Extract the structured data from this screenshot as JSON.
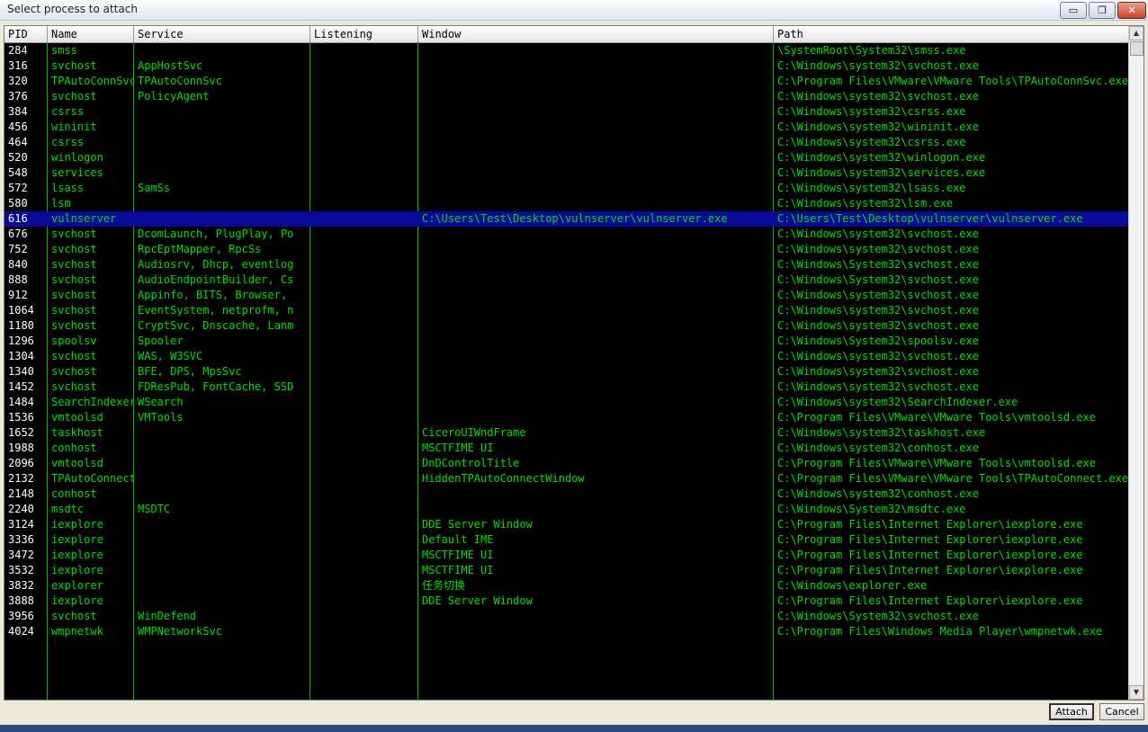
{
  "window": {
    "title": "Select process to attach"
  },
  "columns": [
    {
      "key": "pid",
      "label": "PID"
    },
    {
      "key": "name",
      "label": "Name"
    },
    {
      "key": "service",
      "label": "Service"
    },
    {
      "key": "listening",
      "label": "Listening"
    },
    {
      "key": "window",
      "label": "Window"
    },
    {
      "key": "path",
      "label": "Path"
    }
  ],
  "rows": [
    {
      "pid": "284",
      "name": "smss",
      "service": "",
      "listening": "",
      "window": "",
      "path": "\\SystemRoot\\System32\\smss.exe"
    },
    {
      "pid": "316",
      "name": "svchost",
      "service": "AppHostSvc",
      "listening": "",
      "window": "",
      "path": "C:\\Windows\\system32\\svchost.exe"
    },
    {
      "pid": "320",
      "name": "TPAutoConnSvc",
      "service": "TPAutoConnSvc",
      "listening": "",
      "window": "",
      "path": "C:\\Program Files\\VMware\\VMware Tools\\TPAutoConnSvc.exe"
    },
    {
      "pid": "376",
      "name": "svchost",
      "service": "PolicyAgent",
      "listening": "",
      "window": "",
      "path": "C:\\Windows\\system32\\svchost.exe"
    },
    {
      "pid": "384",
      "name": "csrss",
      "service": "",
      "listening": "",
      "window": "",
      "path": "C:\\Windows\\system32\\csrss.exe"
    },
    {
      "pid": "456",
      "name": "wininit",
      "service": "",
      "listening": "",
      "window": "",
      "path": "C:\\Windows\\system32\\wininit.exe"
    },
    {
      "pid": "464",
      "name": "csrss",
      "service": "",
      "listening": "",
      "window": "",
      "path": "C:\\Windows\\system32\\csrss.exe"
    },
    {
      "pid": "520",
      "name": "winlogon",
      "service": "",
      "listening": "",
      "window": "",
      "path": "C:\\Windows\\system32\\winlogon.exe"
    },
    {
      "pid": "548",
      "name": "services",
      "service": "",
      "listening": "",
      "window": "",
      "path": "C:\\Windows\\system32\\services.exe"
    },
    {
      "pid": "572",
      "name": "lsass",
      "service": "SamSs",
      "listening": "",
      "window": "",
      "path": "C:\\Windows\\system32\\lsass.exe"
    },
    {
      "pid": "580",
      "name": "lsm",
      "service": "",
      "listening": "",
      "window": "",
      "path": "C:\\Windows\\system32\\lsm.exe"
    },
    {
      "pid": "616",
      "name": "vulnserver",
      "service": "",
      "listening": "",
      "window": "C:\\Users\\Test\\Desktop\\vulnserver\\vulnserver.exe",
      "path": "C:\\Users\\Test\\Desktop\\vulnserver\\vulnserver.exe",
      "selected": true
    },
    {
      "pid": "676",
      "name": "svchost",
      "service": "DcomLaunch, PlugPlay, Po",
      "listening": "",
      "window": "",
      "path": "C:\\Windows\\system32\\svchost.exe"
    },
    {
      "pid": "752",
      "name": "svchost",
      "service": "RpcEptMapper, RpcSs",
      "listening": "",
      "window": "",
      "path": "C:\\Windows\\system32\\svchost.exe"
    },
    {
      "pid": "840",
      "name": "svchost",
      "service": "Audiosrv, Dhcp, eventlog",
      "listening": "",
      "window": "",
      "path": "C:\\Windows\\System32\\svchost.exe"
    },
    {
      "pid": "888",
      "name": "svchost",
      "service": "AudioEndpointBuilder, Cs",
      "listening": "",
      "window": "",
      "path": "C:\\Windows\\System32\\svchost.exe"
    },
    {
      "pid": "912",
      "name": "svchost",
      "service": "Appinfo, BITS, Browser,",
      "listening": "",
      "window": "",
      "path": "C:\\Windows\\system32\\svchost.exe"
    },
    {
      "pid": "1064",
      "name": "svchost",
      "service": "EventSystem, netprofm, n",
      "listening": "",
      "window": "",
      "path": "C:\\Windows\\system32\\svchost.exe"
    },
    {
      "pid": "1180",
      "name": "svchost",
      "service": "CryptSvc, Dnscache, Lanm",
      "listening": "",
      "window": "",
      "path": "C:\\Windows\\system32\\svchost.exe"
    },
    {
      "pid": "1296",
      "name": "spoolsv",
      "service": "Spooler",
      "listening": "",
      "window": "",
      "path": "C:\\Windows\\System32\\spoolsv.exe"
    },
    {
      "pid": "1304",
      "name": "svchost",
      "service": "WAS, W3SVC",
      "listening": "",
      "window": "",
      "path": "C:\\Windows\\system32\\svchost.exe"
    },
    {
      "pid": "1340",
      "name": "svchost",
      "service": "BFE, DPS, MpsSvc",
      "listening": "",
      "window": "",
      "path": "C:\\Windows\\system32\\svchost.exe"
    },
    {
      "pid": "1452",
      "name": "svchost",
      "service": "FDResPub, FontCache, SSD",
      "listening": "",
      "window": "",
      "path": "C:\\Windows\\system32\\svchost.exe"
    },
    {
      "pid": "1484",
      "name": "SearchIndexer",
      "service": "WSearch",
      "listening": "",
      "window": "",
      "path": "C:\\Windows\\system32\\SearchIndexer.exe"
    },
    {
      "pid": "1536",
      "name": "vmtoolsd",
      "service": "VMTools",
      "listening": "",
      "window": "",
      "path": "C:\\Program Files\\VMware\\VMware Tools\\vmtoolsd.exe"
    },
    {
      "pid": "1652",
      "name": "taskhost",
      "service": "",
      "listening": "",
      "window": "CiceroUIWndFrame",
      "path": "C:\\Windows\\system32\\taskhost.exe"
    },
    {
      "pid": "1988",
      "name": "conhost",
      "service": "",
      "listening": "",
      "window": "MSCTFIME UI",
      "path": "C:\\Windows\\system32\\conhost.exe"
    },
    {
      "pid": "2096",
      "name": "vmtoolsd",
      "service": "",
      "listening": "",
      "window": "DnDControlTitle",
      "path": "C:\\Program Files\\VMware\\VMware Tools\\vmtoolsd.exe"
    },
    {
      "pid": "2132",
      "name": "TPAutoConnect",
      "service": "",
      "listening": "",
      "window": "HiddenTPAutoConnectWindow",
      "path": "C:\\Program Files\\VMware\\VMware Tools\\TPAutoConnect.exe"
    },
    {
      "pid": "2148",
      "name": "conhost",
      "service": "",
      "listening": "",
      "window": "",
      "path": "C:\\Windows\\system32\\conhost.exe"
    },
    {
      "pid": "2240",
      "name": "msdtc",
      "service": "MSDTC",
      "listening": "",
      "window": "",
      "path": "C:\\Windows\\System32\\msdtc.exe"
    },
    {
      "pid": "3124",
      "name": "iexplore",
      "service": "",
      "listening": "",
      "window": "DDE Server Window",
      "path": "C:\\Program Files\\Internet Explorer\\iexplore.exe"
    },
    {
      "pid": "3336",
      "name": "iexplore",
      "service": "",
      "listening": "",
      "window": "Default IME",
      "path": "C:\\Program Files\\Internet Explorer\\iexplore.exe"
    },
    {
      "pid": "3472",
      "name": "iexplore",
      "service": "",
      "listening": "",
      "window": "MSCTFIME UI",
      "path": "C:\\Program Files\\Internet Explorer\\iexplore.exe"
    },
    {
      "pid": "3532",
      "name": "iexplore",
      "service": "",
      "listening": "",
      "window": "MSCTFIME UI",
      "path": "C:\\Program Files\\Internet Explorer\\iexplore.exe"
    },
    {
      "pid": "3832",
      "name": "explorer",
      "service": "",
      "listening": "",
      "window": "任务切换",
      "path": "C:\\Windows\\explorer.exe"
    },
    {
      "pid": "3888",
      "name": "iexplore",
      "service": "",
      "listening": "",
      "window": "DDE Server Window",
      "path": "C:\\Program Files\\Internet Explorer\\iexplore.exe"
    },
    {
      "pid": "3956",
      "name": "svchost",
      "service": "WinDefend",
      "listening": "",
      "window": "",
      "path": "C:\\Windows\\System32\\svchost.exe"
    },
    {
      "pid": "4024",
      "name": "wmpnetwk",
      "service": "WMPNetworkSvc",
      "listening": "",
      "window": "",
      "path": "C:\\Program Files\\Windows Media Player\\wmpnetwk.exe"
    }
  ],
  "buttons": {
    "attach": "Attach",
    "cancel": "Cancel"
  },
  "window_controls": {
    "minimize": "▭",
    "maximize": "❐",
    "close": "✕"
  },
  "colors": {
    "list_bg": "#000000",
    "text": "#00e000",
    "selection": "#0a0a9a",
    "grid": "#00c000"
  }
}
